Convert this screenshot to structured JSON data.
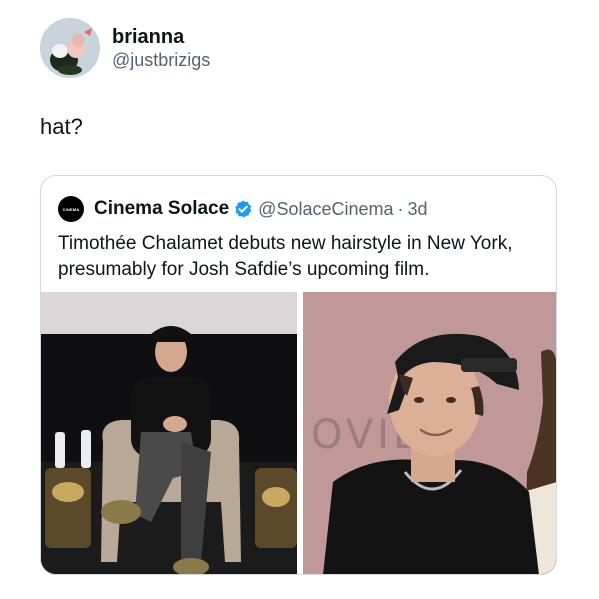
{
  "author": {
    "name": "brianna",
    "handle": "@justbrizigs"
  },
  "tweet": {
    "text": "hat?"
  },
  "quoted_tweet": {
    "avatar_text": "CINEMA",
    "name": "Cinema Solace",
    "handle": "@SolaceCinema",
    "separator": "·",
    "time": "3d",
    "text": "Timothée Chalamet debuts new hairstyle in New York, presumably for Josh Safdie’s upcoming film.",
    "images": [
      {
        "icon": "photo-seated-on-stage"
      },
      {
        "icon": "photo-closeup-backwards-cap",
        "backdrop_text": "OVIE"
      }
    ]
  },
  "colors": {
    "text_primary": "#0f1419",
    "text_secondary": "#536471",
    "border": "#cfd9de",
    "verified_blue": "#1d9bf0"
  }
}
